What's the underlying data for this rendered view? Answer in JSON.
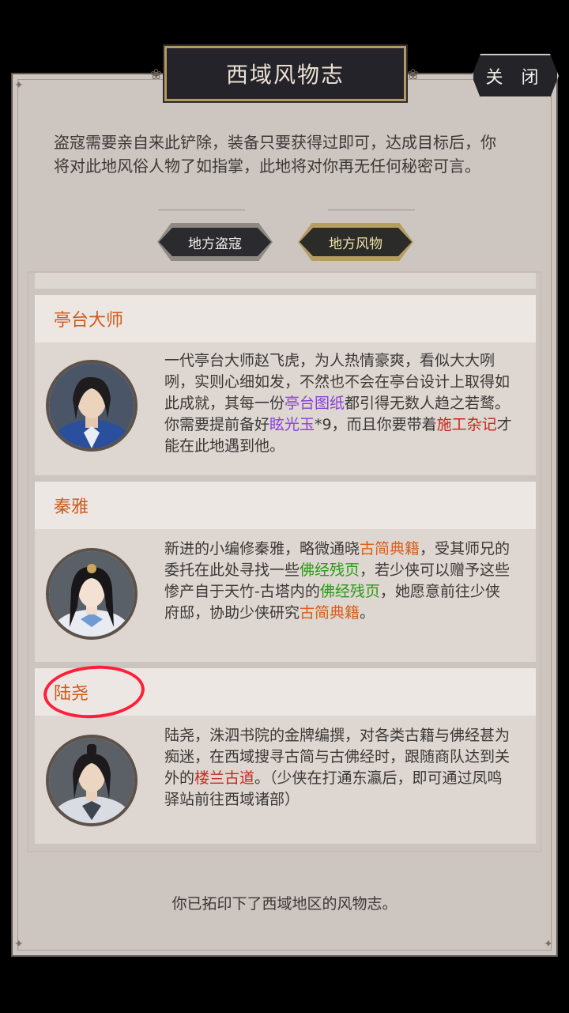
{
  "title": "西域风物志",
  "close_label": "关 闭",
  "intro_text": "盗寇需要亲自来此铲除，装备只要获得过即可，达成目标后，你将对此地风俗人物了如指掌，此地将对你再无任何秘密可言。",
  "tabs": [
    {
      "label": "地方盗寇",
      "active": false
    },
    {
      "label": "地方风物",
      "active": true
    }
  ],
  "characters": [
    {
      "name": "亭台大师",
      "portrait": "male-scholar-blue-robe-avatar",
      "desc_parts": [
        {
          "text": "一代亭台大师赵飞虎，为人热情豪爽，看似大大咧咧，实则心细如发，不然也不会在亭台设计上取得如此成就，其每一份",
          "color": ""
        },
        {
          "text": "亭台图纸",
          "color": "purple"
        },
        {
          "text": "都引得无数人趋之若鹜。你需要提前备好",
          "color": ""
        },
        {
          "text": "眩光玉",
          "color": "purple"
        },
        {
          "text": "*9，而且你要带着",
          "color": ""
        },
        {
          "text": "施工杂记",
          "color": "red"
        },
        {
          "text": "才能在此地遇到他。",
          "color": ""
        }
      ]
    },
    {
      "name": "秦雅",
      "portrait": "female-scholar-avatar",
      "desc_parts": [
        {
          "text": "新进的小编修秦雅，略微通晓",
          "color": ""
        },
        {
          "text": "古简典籍",
          "color": "orange"
        },
        {
          "text": "，受其师兄的委托在此处寻找一些",
          "color": ""
        },
        {
          "text": "佛经残页",
          "color": "green"
        },
        {
          "text": "，若少侠可以赠予这些惨产自于天竹-古塔内的",
          "color": ""
        },
        {
          "text": "佛经残页",
          "color": "green"
        },
        {
          "text": "，她愿意前往少侠府邸，协助少侠研究",
          "color": ""
        },
        {
          "text": "古简典籍",
          "color": "orange"
        },
        {
          "text": "。",
          "color": ""
        }
      ]
    },
    {
      "name": "陆尧",
      "portrait": "male-scholar-white-robe-avatar",
      "desc_parts": [
        {
          "text": "陆尧，洙泗书院的金牌编撰，对各类古籍与佛经甚为痴迷，在西域搜寻古简与古佛经时，跟随商队达到关外的",
          "color": ""
        },
        {
          "text": "楼兰古道",
          "color": "red"
        },
        {
          "text": "。（少侠在打通东瀛后，即可通过凤鸣驿站前往西域诸部）",
          "color": ""
        }
      ]
    }
  ],
  "footer": "你已拓印下了西域地区的风物志。",
  "colors": {
    "name": "#cf5a1a",
    "purple": "#8a3fd9",
    "red": "#c8281f",
    "green": "#2b9a18",
    "orange": "#d95f1a",
    "annotation": "#ff1f3a"
  }
}
